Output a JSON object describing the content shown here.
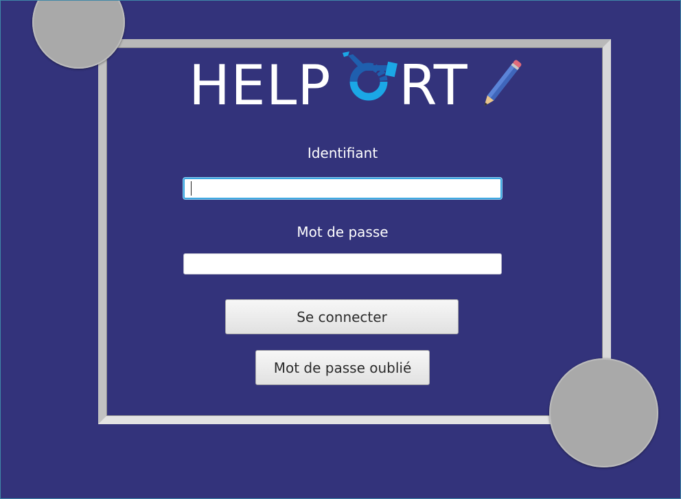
{
  "logo": {
    "text_left": "HELP",
    "text_right": "RT",
    "mark_icon": "wheelchair-o-icon",
    "pencil_icon": "pencil-icon",
    "colors": {
      "blue_dark": "#1f5fae",
      "blue_light": "#1ba7e6"
    }
  },
  "form": {
    "identifiant_label": "Identifiant",
    "identifiant_value": "",
    "password_label": "Mot de passe",
    "password_value": "",
    "connect_button": "Se connecter",
    "forgot_button": "Mot de passe oublié"
  },
  "colors": {
    "background": "#33337b",
    "frame": "#c9c9c9",
    "circle": "#a9a9a9",
    "focus": "#3ba6e0"
  }
}
